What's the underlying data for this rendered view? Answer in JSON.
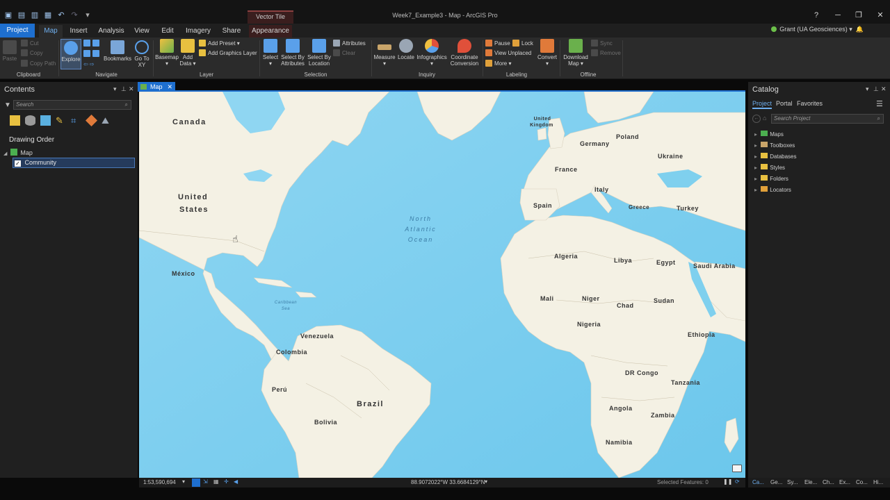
{
  "window": {
    "title": "Week7_Example3 - Map - ArcGIS Pro",
    "contextual_tab_group": "Vector Tile Layer"
  },
  "tabs": [
    "Project",
    "Map",
    "Insert",
    "Analysis",
    "View",
    "Edit",
    "Imagery",
    "Share",
    "Appearance"
  ],
  "user": {
    "name": "Grant (UA Geosciences)"
  },
  "ribbon": {
    "clipboard": {
      "label": "Clipboard",
      "paste": "Paste",
      "cut": "Cut",
      "copy": "Copy",
      "copy_path": "Copy Path"
    },
    "navigate": {
      "label": "Navigate",
      "explore": "Explore",
      "bookmarks": "Bookmarks",
      "goto_xy": "Go To XY"
    },
    "layer": {
      "label": "Layer",
      "basemap": "Basemap",
      "add_data": "Add Data",
      "add_preset": "Add Preset",
      "add_graphics_layer": "Add Graphics Layer"
    },
    "selection": {
      "label": "Selection",
      "select": "Select",
      "select_by_attributes": "Select By Attributes",
      "select_by_location": "Select By Location",
      "attributes": "Attributes",
      "clear": "Clear"
    },
    "inquiry": {
      "label": "Inquiry",
      "measure": "Measure",
      "locate": "Locate",
      "infographics": "Infographics",
      "coordinate_conversion": "Coordinate Conversion"
    },
    "labeling": {
      "label": "Labeling",
      "pause": "Pause",
      "lock": "Lock",
      "view_unplaced": "View Unplaced",
      "more": "More",
      "convert": "Convert"
    },
    "offline": {
      "label": "Offline",
      "download_map": "Download Map",
      "sync": "Sync",
      "remove": "Remove"
    }
  },
  "contents": {
    "title": "Contents",
    "search_placeholder": "Search",
    "drawing_order": "Drawing Order",
    "map_item": "Map",
    "layer_item": "Community"
  },
  "map_view": {
    "tab_label": "Map",
    "labels": {
      "canada": "Canada",
      "united_states_1": "United",
      "united_states_2": "States",
      "mexico": "México",
      "ocean_1": "North",
      "ocean_2": "Atlantic",
      "ocean_3": "Ocean",
      "caribbean_1": "Caribbean",
      "caribbean_2": "Sea",
      "venezuela": "Venezuela",
      "colombia": "Colombia",
      "peru": "Perú",
      "brazil": "Brazil",
      "bolivia": "Bolivia",
      "uk_1": "United",
      "uk_2": "Kingdom",
      "poland": "Poland",
      "germany": "Germany",
      "ukraine": "Ukraine",
      "france": "France",
      "italy": "Italy",
      "spain": "Spain",
      "greece": "Greece",
      "turkey": "Turkey",
      "algeria": "Algeria",
      "libya": "Libya",
      "egypt": "Egypt",
      "saudi_arabia": "Saudi Arabia",
      "mali": "Mali",
      "niger": "Niger",
      "chad": "Chad",
      "sudan": "Sudan",
      "nigeria": "Nigeria",
      "ethiopia": "Ethiopia",
      "dr_congo": "DR Congo",
      "tanzania": "Tanzania",
      "angola": "Angola",
      "zambia": "Zambia",
      "namibia": "Namibia"
    }
  },
  "statusbar": {
    "scale": "1:53,590,694",
    "coordinates": "88.9072022°W 33.6684129°N",
    "selected_features": "Selected Features: 0"
  },
  "catalog": {
    "title": "Catalog",
    "tabs": [
      "Project",
      "Portal",
      "Favorites"
    ],
    "search_placeholder": "Search Project",
    "items": [
      "Maps",
      "Toolboxes",
      "Databases",
      "Styles",
      "Folders",
      "Locators"
    ],
    "bottom_tabs": [
      "Ca...",
      "Ge...",
      "Sy...",
      "Ele...",
      "Ch...",
      "Ex...",
      "Co...",
      "Hi..."
    ]
  },
  "colors": {
    "accent": "#1e6fcf",
    "water": "#7fd0ee",
    "land": "#f4f1e4",
    "ribbon_bg": "#2b2b2b"
  }
}
